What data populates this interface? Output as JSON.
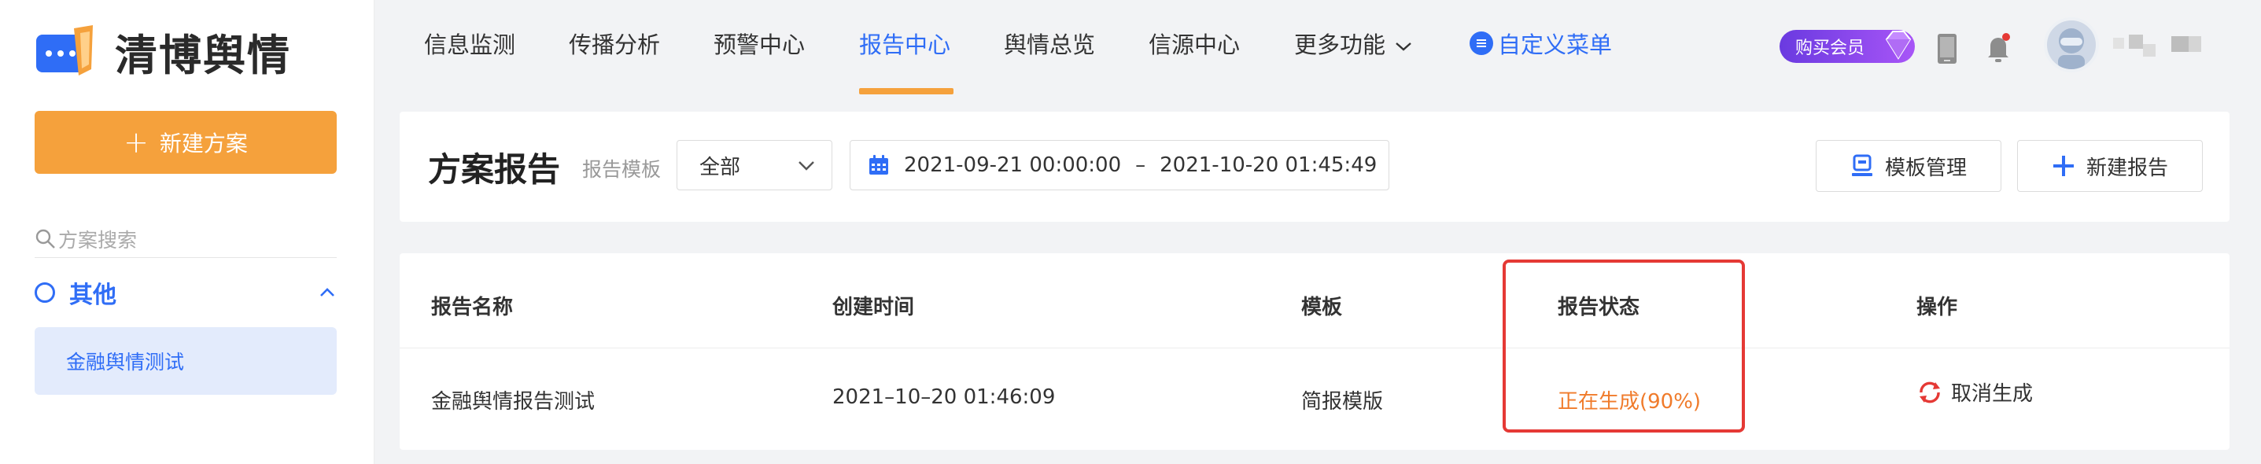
{
  "app": {
    "logo_text": "清博舆情"
  },
  "sidebar": {
    "new_plan_label": "新建方案",
    "search_placeholder": "方案搜索",
    "group": {
      "label": "其他",
      "items": [
        {
          "label": "金融舆情测试"
        }
      ]
    }
  },
  "nav": {
    "items": [
      {
        "label": "信息监测"
      },
      {
        "label": "传播分析"
      },
      {
        "label": "预警中心"
      },
      {
        "label": "报告中心",
        "active": true
      },
      {
        "label": "舆情总览"
      },
      {
        "label": "信源中心"
      },
      {
        "label": "更多功能"
      }
    ],
    "custom_menu_label": "自定义菜单",
    "vip_label": "购买会员"
  },
  "filter": {
    "page_title": "方案报告",
    "template_label": "报告模板",
    "template_select_value": "全部",
    "date_start": "2021-09-21 00:00:00",
    "date_sep": "–",
    "date_end": "2021-10-20 01:45:49",
    "template_manage_label": "模板管理",
    "new_report_label": "新建报告"
  },
  "table": {
    "columns": [
      "报告名称",
      "创建时间",
      "模板",
      "报告状态",
      "操作"
    ],
    "rows": [
      {
        "name": "金融舆情报告测试",
        "created": "2021–10–20 01:46:09",
        "template": "简报模版",
        "status": "正在生成(90%)",
        "action": "取消生成"
      }
    ]
  },
  "colors": {
    "accent": "#2f6df6",
    "orange": "#f5a13c",
    "status": "#f07b2b",
    "highlight": "#e53935"
  },
  "icons": [
    "logo-icon",
    "plus-icon",
    "search-icon",
    "circle-icon",
    "chevron-up-icon",
    "chevron-down-icon",
    "menu-icon",
    "gem-icon",
    "phone-icon",
    "bell-icon",
    "calendar-icon",
    "template-icon",
    "refresh-icon"
  ]
}
